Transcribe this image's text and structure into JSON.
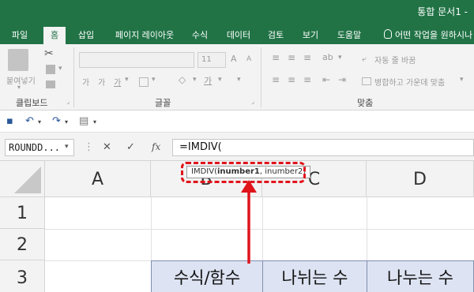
{
  "title": "통합 문서1 -",
  "tabs": [
    {
      "label": "파일"
    },
    {
      "label": "홈"
    },
    {
      "label": "삽입"
    },
    {
      "label": "페이지 레이아웃"
    },
    {
      "label": "수식"
    },
    {
      "label": "데이터"
    },
    {
      "label": "검토"
    },
    {
      "label": "보기"
    },
    {
      "label": "도움말"
    }
  ],
  "tellme": "어떤 작업을 원하시나",
  "ribbon": {
    "paste": "붙여넣기",
    "font_size": "11",
    "wrap_text": "자동 줄 바꿈",
    "merge_center": "병합하고 가운데 맞춤",
    "groups": {
      "clipboard": "클립보드",
      "font": "글꼴",
      "alignment": "맞춤"
    }
  },
  "name_box": "ROUNDD...",
  "fx": "fx",
  "formula": "=IMDIV(",
  "tooltip": {
    "func": "IMDIV(",
    "arg1": "inumber1",
    "rest": ", inumber2)"
  },
  "columns": [
    "A",
    "B",
    "C",
    "D"
  ],
  "rows": [
    "1",
    "2",
    "3"
  ],
  "row3_cells": {
    "b": "수식/함수",
    "c": "나뉘는 수",
    "d": "나누는 수"
  },
  "colors": {
    "excel_green": "#217346",
    "annotation_red": "#e0141b",
    "header_fill": "#dde3f2"
  }
}
